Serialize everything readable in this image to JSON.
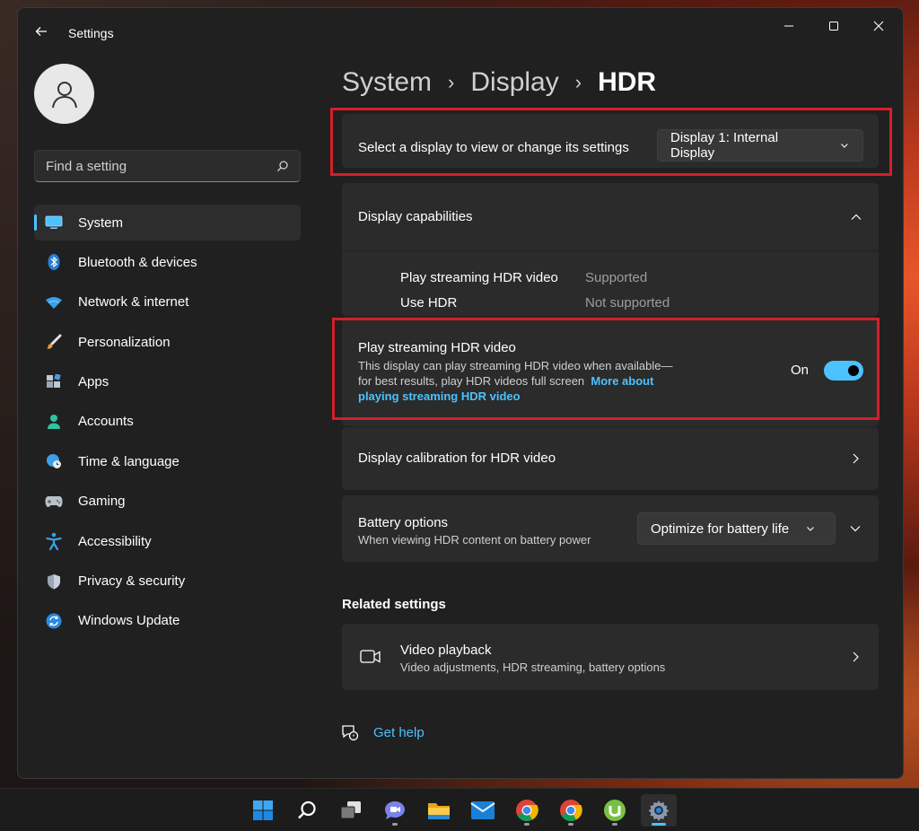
{
  "window": {
    "title": "Settings"
  },
  "search": {
    "placeholder": "Find a setting"
  },
  "sidebar": {
    "items": [
      {
        "label": "System",
        "icon": "monitor-icon",
        "active": true
      },
      {
        "label": "Bluetooth & devices",
        "icon": "bluetooth-icon"
      },
      {
        "label": "Network & internet",
        "icon": "wifi-icon"
      },
      {
        "label": "Personalization",
        "icon": "paintbrush-icon"
      },
      {
        "label": "Apps",
        "icon": "apps-icon"
      },
      {
        "label": "Accounts",
        "icon": "person-icon"
      },
      {
        "label": "Time & language",
        "icon": "globe-clock-icon"
      },
      {
        "label": "Gaming",
        "icon": "gamepad-icon"
      },
      {
        "label": "Accessibility",
        "icon": "accessibility-icon"
      },
      {
        "label": "Privacy & security",
        "icon": "shield-icon"
      },
      {
        "label": "Windows Update",
        "icon": "update-icon"
      }
    ]
  },
  "breadcrumb": {
    "items": [
      "System",
      "Display",
      "HDR"
    ],
    "separator": "›"
  },
  "display_select": {
    "label": "Select a display to view or change its settings",
    "value": "Display 1: Internal Display"
  },
  "capabilities": {
    "title": "Display capabilities",
    "rows": [
      {
        "name": "Play streaming HDR video",
        "value": "Supported"
      },
      {
        "name": "Use HDR",
        "value": "Not supported"
      }
    ]
  },
  "hdr_video": {
    "title": "Play streaming HDR video",
    "desc_line1": "This display can play streaming HDR video when available—",
    "desc_line2": "for best results, play HDR videos full screen",
    "link_part1": "More about",
    "link_part2": "playing streaming HDR video",
    "state_label": "On",
    "enabled": true
  },
  "calibration": {
    "title": "Display calibration for HDR video"
  },
  "battery": {
    "title": "Battery options",
    "subtitle": "When viewing HDR content on battery power",
    "value": "Optimize for battery life"
  },
  "related": {
    "title": "Related settings",
    "items": [
      {
        "title": "Video playback",
        "subtitle": "Video adjustments, HDR streaming, battery options",
        "icon": "video-camera-icon"
      }
    ]
  },
  "help": {
    "label": "Get help"
  },
  "colors": {
    "accent": "#4cc2ff",
    "highlight_box": "#d51e2a",
    "card_bg": "#2b2b2b",
    "window_bg": "#202020"
  },
  "taskbar": {
    "items": [
      "windows-start-icon",
      "search-icon",
      "task-view-icon",
      "teams-chat-icon",
      "file-explorer-icon",
      "mail-icon",
      "chrome-icon",
      "chrome-icon",
      "utorrent-icon",
      "settings-icon"
    ]
  }
}
